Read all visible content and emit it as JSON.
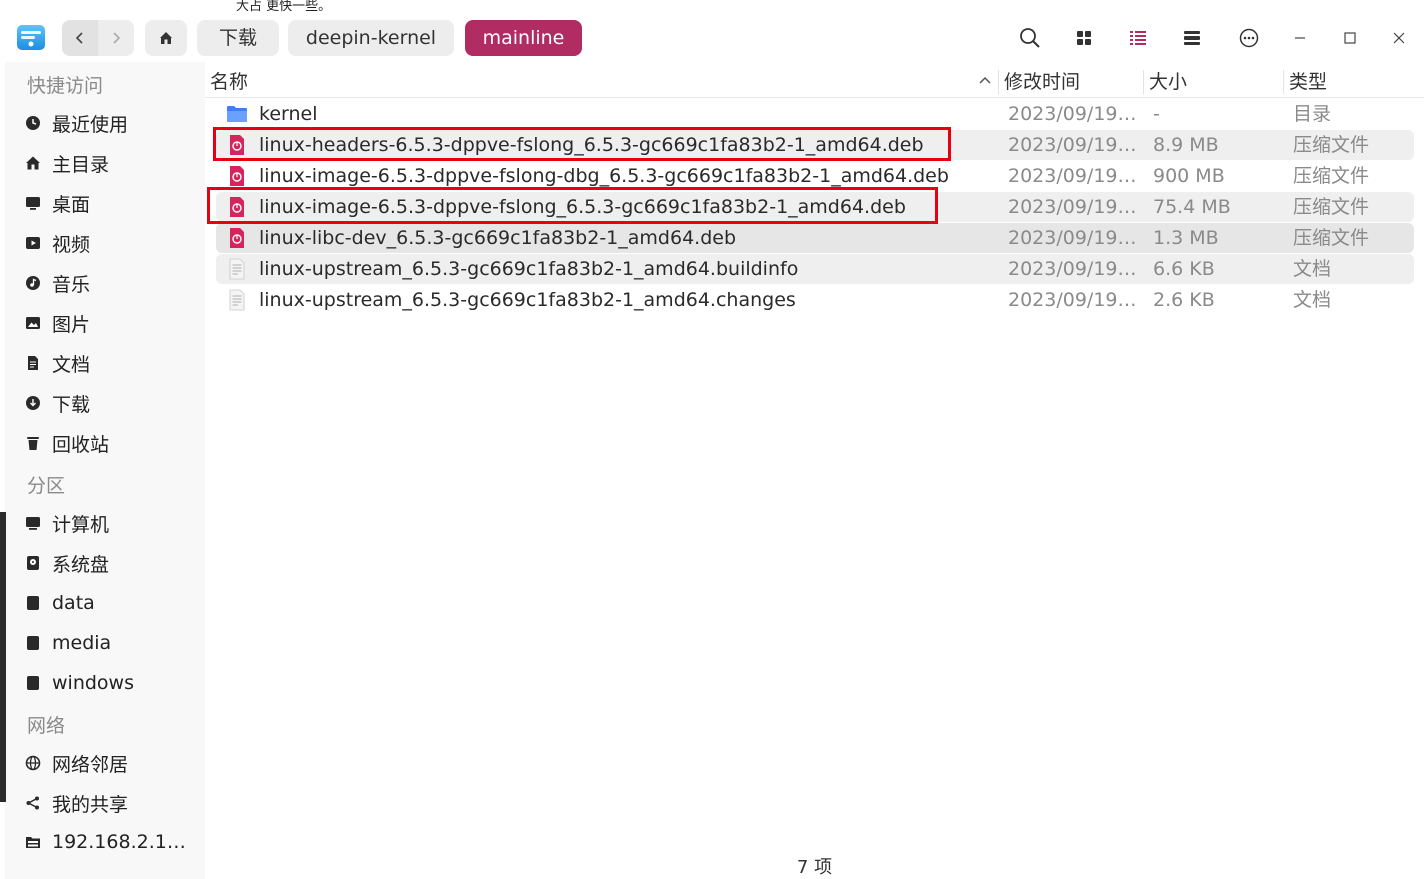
{
  "overlay_text": "大占  更快一些。",
  "breadcrumbs": [
    "下载",
    "deepin-kernel",
    "mainline"
  ],
  "accent_color": "#b02c62",
  "highlight_color": "#e60012",
  "toolbar": {
    "search": "search-icon",
    "icon_view": "grid-icon",
    "list_view": "list-icon",
    "detail_view": "detail-icon",
    "more": "more-icon"
  },
  "sidebar": {
    "quick_access_title": "快捷访问",
    "quick_access": [
      {
        "label": "最近使用",
        "icon": "clock-icon"
      },
      {
        "label": "主目录",
        "icon": "home-icon"
      },
      {
        "label": "桌面",
        "icon": "desktop-icon"
      },
      {
        "label": "视频",
        "icon": "video-icon"
      },
      {
        "label": "音乐",
        "icon": "music-icon"
      },
      {
        "label": "图片",
        "icon": "picture-icon"
      },
      {
        "label": "文档",
        "icon": "document-icon"
      },
      {
        "label": "下载",
        "icon": "download-icon"
      },
      {
        "label": "回收站",
        "icon": "trash-icon"
      }
    ],
    "partitions_title": "分区",
    "partitions": [
      {
        "label": "计算机",
        "icon": "computer-icon"
      },
      {
        "label": "系统盘",
        "icon": "system-disk-icon"
      },
      {
        "label": "data",
        "icon": "disk-icon"
      },
      {
        "label": "media",
        "icon": "disk-icon"
      },
      {
        "label": "windows",
        "icon": "disk-icon"
      }
    ],
    "network_title": "网络",
    "network": [
      {
        "label": "网络邻居",
        "icon": "network-icon"
      },
      {
        "label": "我的共享",
        "icon": "share-icon"
      },
      {
        "label": "192.168.2.1…",
        "icon": "server-icon"
      }
    ]
  },
  "columns": {
    "name": "名称",
    "modified": "修改时间",
    "size": "大小",
    "type": "类型"
  },
  "files": [
    {
      "name": "kernel",
      "modified": "2023/09/19…",
      "size": "-",
      "type": "目录",
      "icon": "folder-icon",
      "highlighted": false
    },
    {
      "name": "linux-headers-6.5.3-dppve-fslong_6.5.3-gc669c1fa83b2-1_amd64.deb",
      "modified": "2023/09/19…",
      "size": "8.9 MB",
      "type": "压缩文件",
      "icon": "deb-package-icon",
      "highlighted": true
    },
    {
      "name": "linux-image-6.5.3-dppve-fslong-dbg_6.5.3-gc669c1fa83b2-1_amd64.deb",
      "modified": "2023/09/19…",
      "size": "900 MB",
      "type": "压缩文件",
      "icon": "deb-package-icon",
      "highlighted": false
    },
    {
      "name": "linux-image-6.5.3-dppve-fslong_6.5.3-gc669c1fa83b2-1_amd64.deb",
      "modified": "2023/09/19…",
      "size": "75.4 MB",
      "type": "压缩文件",
      "icon": "deb-package-icon",
      "highlighted": true
    },
    {
      "name": "linux-libc-dev_6.5.3-gc669c1fa83b2-1_amd64.deb",
      "modified": "2023/09/19…",
      "size": "1.3 MB",
      "type": "压缩文件",
      "icon": "deb-package-icon",
      "highlighted": false
    },
    {
      "name": "linux-upstream_6.5.3-gc669c1fa83b2-1_amd64.buildinfo",
      "modified": "2023/09/19…",
      "size": "6.6 KB",
      "type": "文档",
      "icon": "text-file-icon",
      "highlighted": false
    },
    {
      "name": "linux-upstream_6.5.3-gc669c1fa83b2-1_amd64.changes",
      "modified": "2023/09/19…",
      "size": "2.6 KB",
      "type": "文档",
      "icon": "text-file-icon",
      "highlighted": false
    }
  ],
  "status": {
    "item_count": "7 项"
  }
}
